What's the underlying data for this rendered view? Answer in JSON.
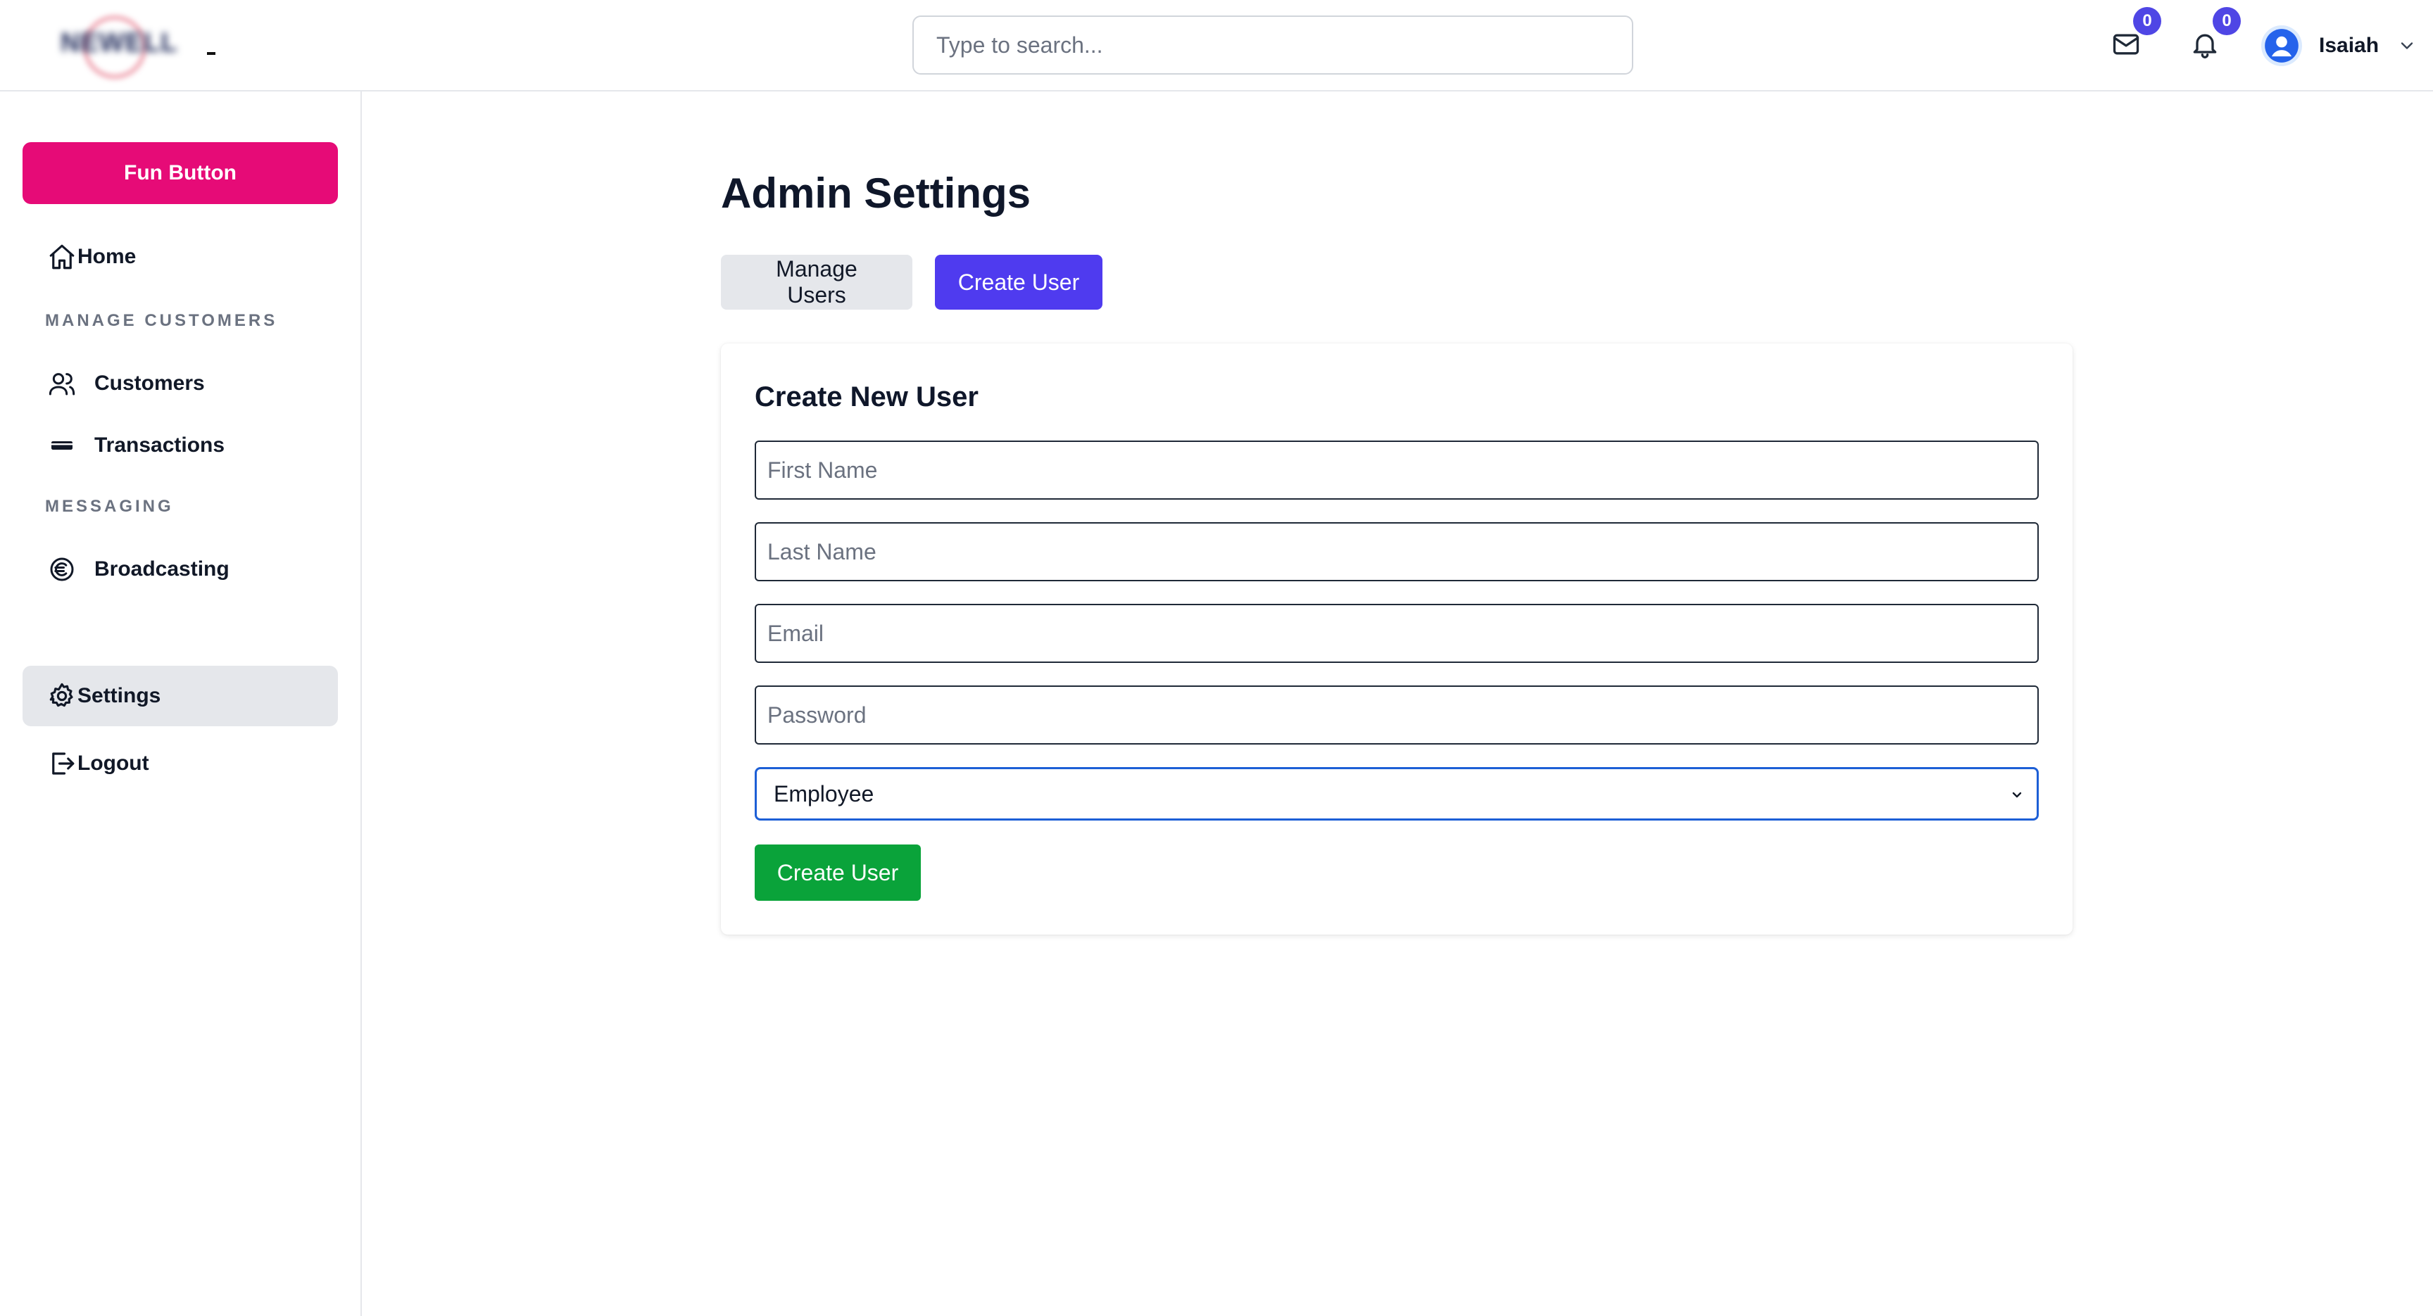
{
  "header": {
    "logo_text": "NEWELL",
    "search_placeholder": "Type to search...",
    "mail_count": "0",
    "notification_count": "0",
    "user_name": "Isaiah"
  },
  "sidebar": {
    "fun_button": "Fun Button",
    "home": "Home",
    "section_customers": "MANAGE CUSTOMERS",
    "customers": "Customers",
    "transactions": "Transactions",
    "section_messaging": "MESSAGING",
    "broadcasting": "Broadcasting",
    "settings": "Settings",
    "logout": "Logout",
    "active_item": "Settings"
  },
  "main": {
    "title": "Admin Settings",
    "tabs": [
      {
        "label": "Manage Users",
        "active": false
      },
      {
        "label": "Create User",
        "active": true
      }
    ],
    "form": {
      "title": "Create New User",
      "first_name_placeholder": "First Name",
      "last_name_placeholder": "Last Name",
      "email_placeholder": "Email",
      "password_placeholder": "Password",
      "role_selected": "Employee",
      "submit_label": "Create User"
    }
  },
  "colors": {
    "fun_button": "#e60b77",
    "accent": "#4f3bef",
    "submit": "#0aa33a",
    "badge": "#4f46e5",
    "select_focus": "#1d5fd6"
  }
}
